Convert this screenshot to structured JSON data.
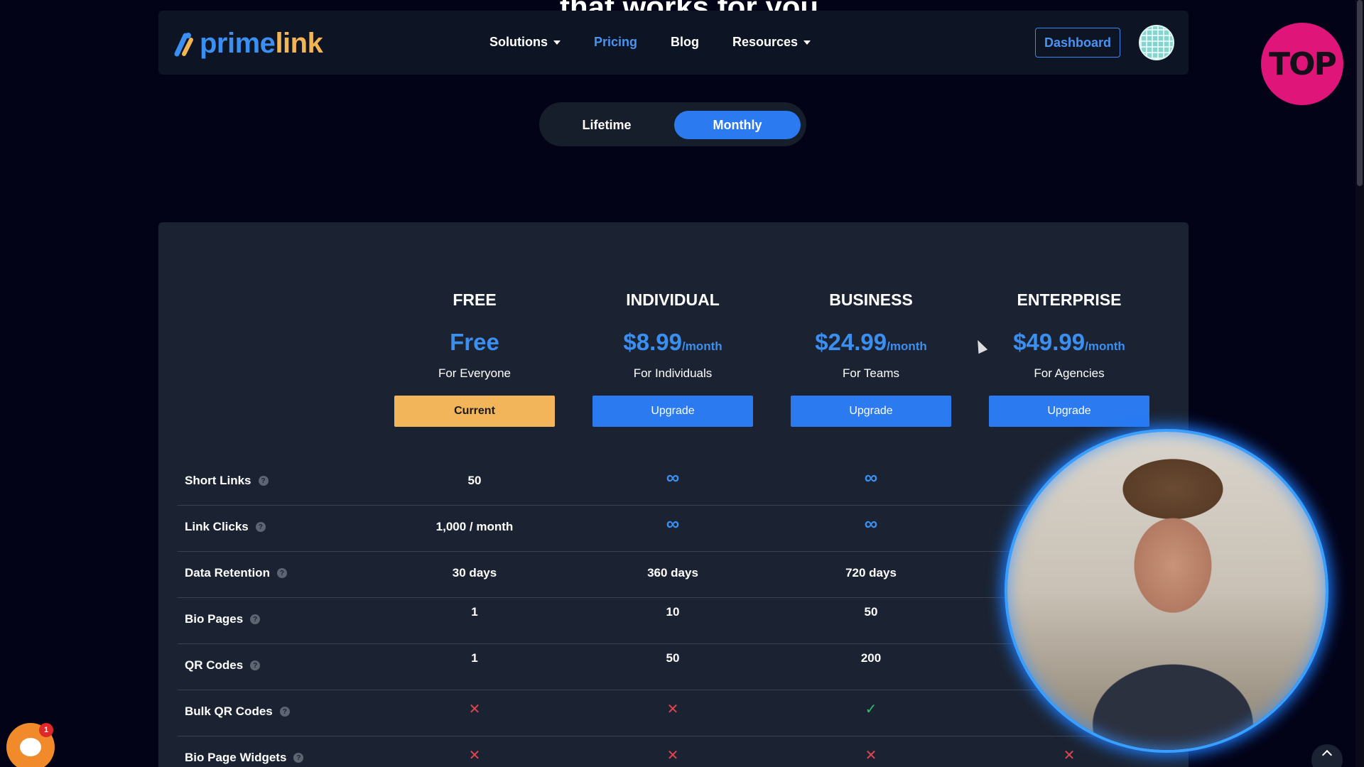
{
  "hero": {
    "heading_clip": "that works for you"
  },
  "navbar": {
    "logo": {
      "prime": "prime",
      "link": "link"
    },
    "links": [
      {
        "label": "Solutions",
        "has_dropdown": true,
        "active": false
      },
      {
        "label": "Pricing",
        "has_dropdown": false,
        "active": true
      },
      {
        "label": "Blog",
        "has_dropdown": false,
        "active": false
      },
      {
        "label": "Resources",
        "has_dropdown": true,
        "active": false
      }
    ],
    "dashboard_label": "Dashboard"
  },
  "overlay_logo": {
    "text": "TOP",
    "color": "#e0157a"
  },
  "billing_toggle": {
    "options": [
      "Lifetime",
      "Monthly"
    ],
    "selected": "Monthly"
  },
  "plans": [
    {
      "name": "FREE",
      "price": "Free",
      "period": "",
      "desc": "For Everyone",
      "button": "Current",
      "current": true
    },
    {
      "name": "INDIVIDUAL",
      "price": "$8.99",
      "period": "/month",
      "desc": "For Individuals",
      "button": "Upgrade",
      "current": false
    },
    {
      "name": "BUSINESS",
      "price": "$24.99",
      "period": "/month",
      "desc": "For Teams",
      "button": "Upgrade",
      "current": false
    },
    {
      "name": "ENTERPRISE",
      "price": "$49.99",
      "period": "/month",
      "desc": "For Agencies",
      "button": "Upgrade",
      "current": false
    }
  ],
  "features": [
    {
      "label": "Short Links",
      "values": [
        "50",
        "∞",
        "∞",
        ""
      ]
    },
    {
      "label": "Link Clicks",
      "values": [
        "1,000 / month",
        "∞",
        "∞",
        ""
      ]
    },
    {
      "label": "Data Retention",
      "values": [
        "30 days",
        "360 days",
        "720 days",
        ""
      ]
    },
    {
      "label": "Bio Pages",
      "values": [
        "1",
        "10",
        "50",
        ""
      ]
    },
    {
      "label": "QR Codes",
      "values": [
        "1",
        "50",
        "200",
        ""
      ]
    },
    {
      "label": "Bulk QR Codes",
      "values": [
        "✕",
        "✕",
        "✓",
        ""
      ]
    },
    {
      "label": "Bio Page Widgets",
      "values": [
        "✕",
        "✕",
        "✕",
        "✕"
      ]
    }
  ],
  "chat_widget": {
    "badge_count": "1"
  },
  "colors": {
    "accent": "#2b7af0",
    "current_button": "#f3b55a",
    "background": "#030318",
    "card": "#1b2332"
  }
}
